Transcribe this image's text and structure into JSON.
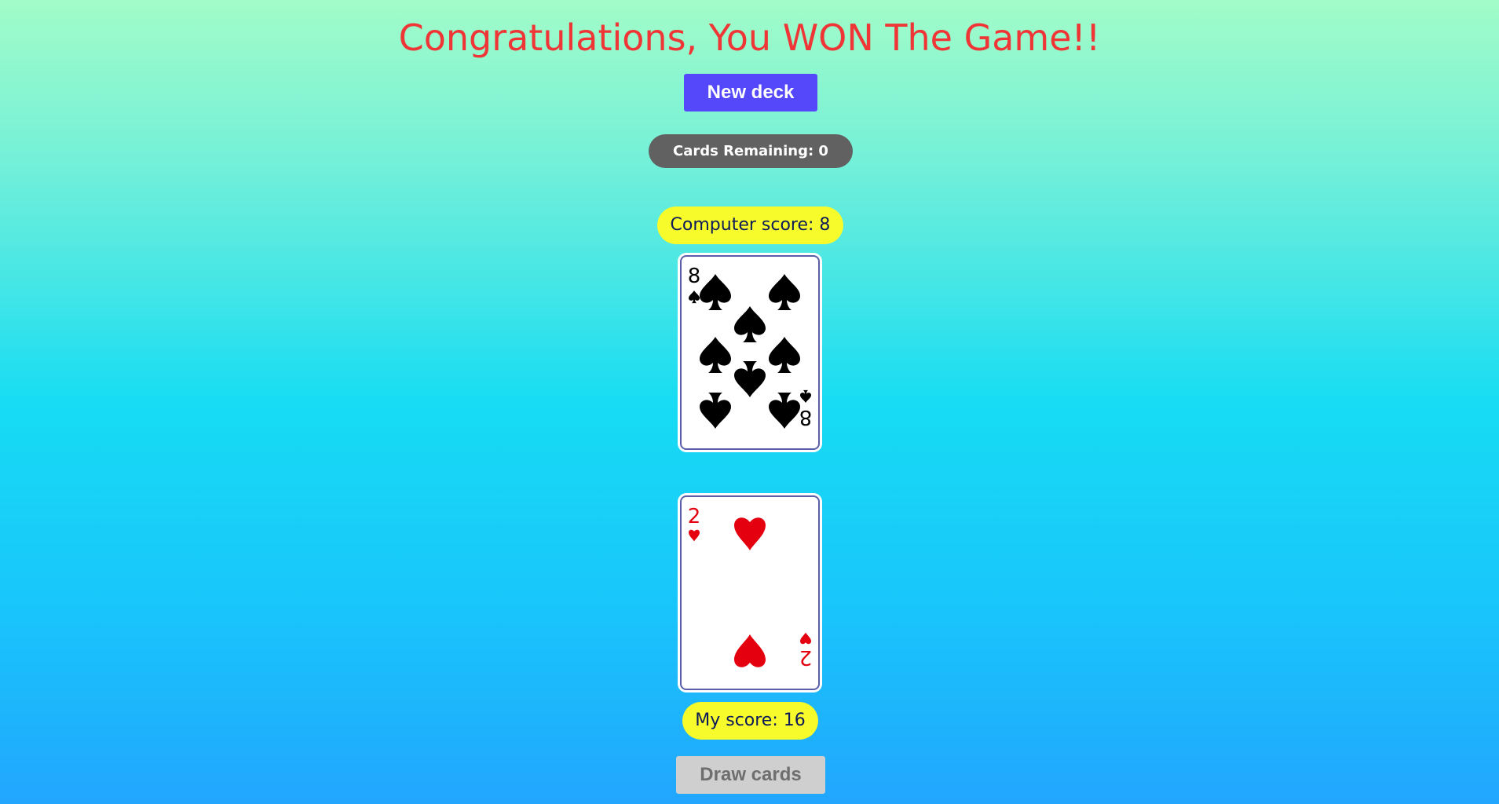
{
  "game": {
    "title": "Congratulations, You WON The Game!!",
    "new_deck_label": "New deck",
    "cards_remaining_text": "Cards Remaining: 0",
    "computer_score_text": "Computer score: 8",
    "my_score_text": "My score: 16",
    "draw_cards_label": "Draw cards"
  },
  "cards": {
    "computer": {
      "rank": "8",
      "suit": "spades",
      "color": "#000000"
    },
    "mine": {
      "rank": "2",
      "suit": "hearts",
      "color": "#e4000f"
    }
  },
  "colors": {
    "title": "#ef3535",
    "new_deck_button": "#5547fa",
    "remaining_badge": "#616161",
    "score_badge": "#f8fb2b",
    "draw_button_disabled": "#cfcfcf"
  }
}
